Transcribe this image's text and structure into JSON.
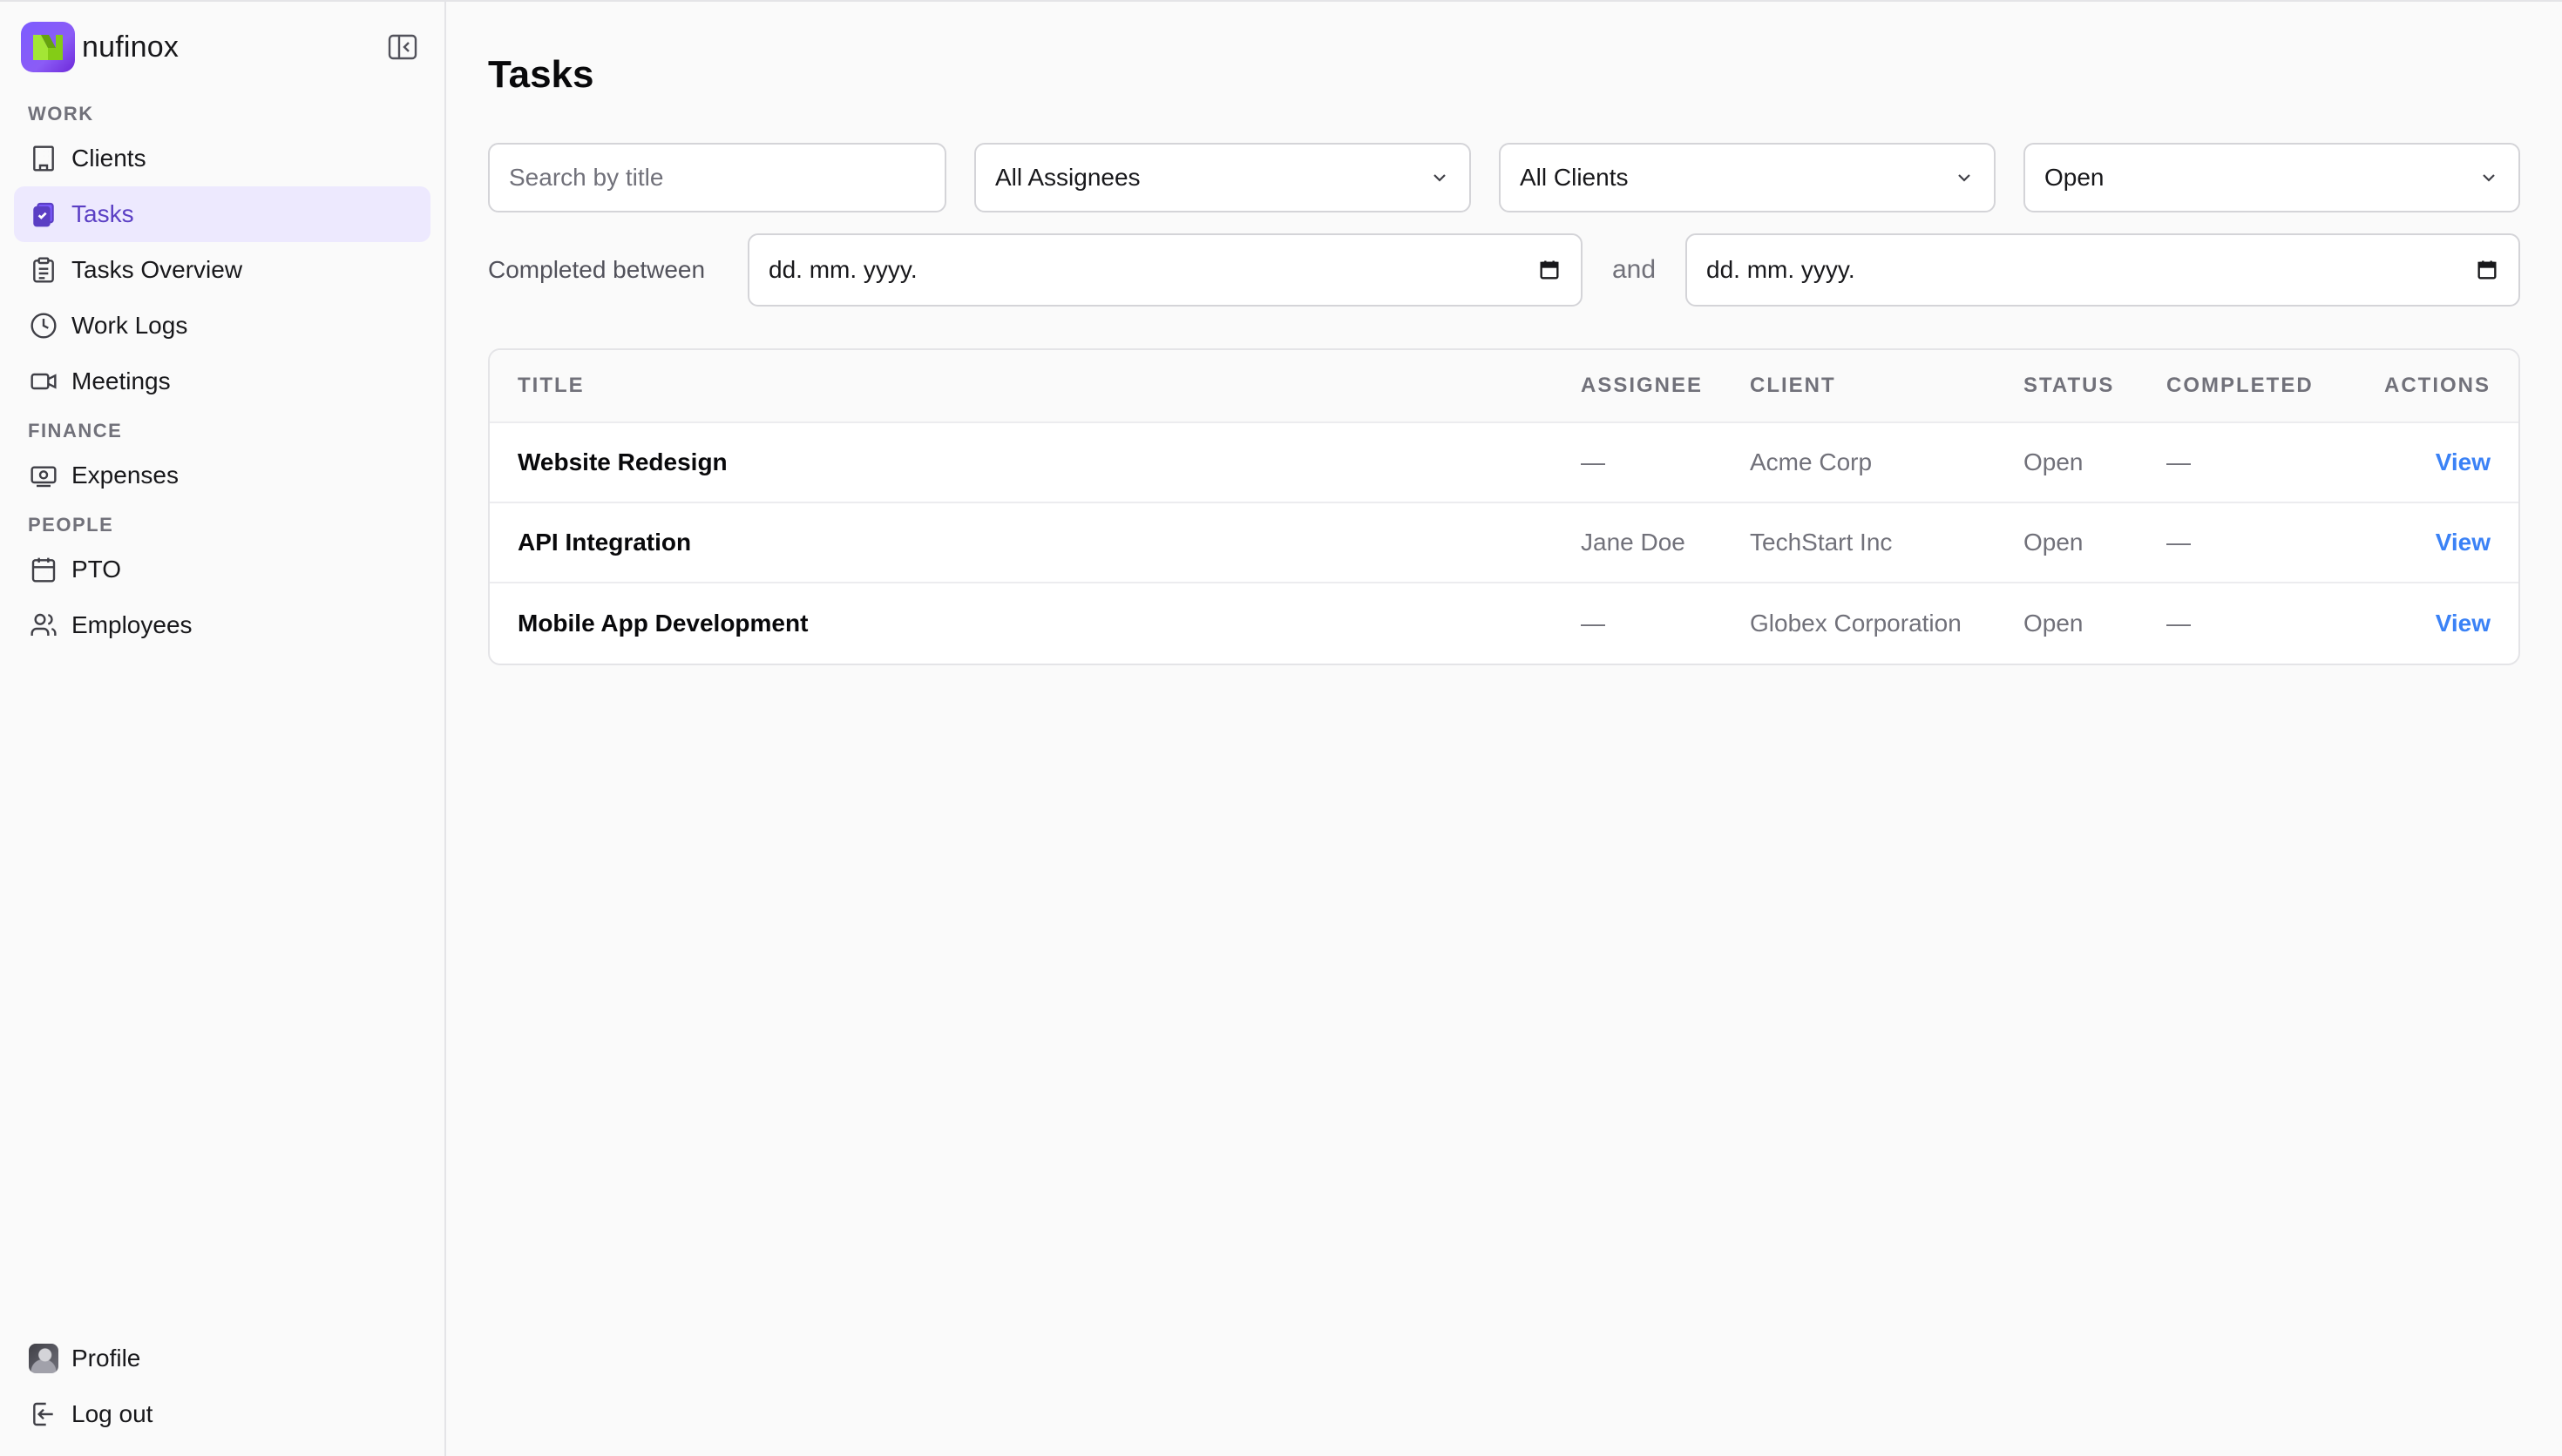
{
  "brand": {
    "name": "nufinox",
    "accent": "#7c5cff"
  },
  "sidebar": {
    "sections": {
      "work": "WORK",
      "finance": "FINANCE",
      "people": "PEOPLE"
    },
    "items": [
      {
        "label": "Clients",
        "icon": "building-icon"
      },
      {
        "label": "Tasks",
        "icon": "tasks-icon",
        "active": true
      },
      {
        "label": "Tasks Overview",
        "icon": "clipboard-icon"
      },
      {
        "label": "Work Logs",
        "icon": "clock-icon"
      },
      {
        "label": "Meetings",
        "icon": "video-icon"
      },
      {
        "label": "Expenses",
        "icon": "banknote-icon"
      },
      {
        "label": "PTO",
        "icon": "calendar-icon"
      },
      {
        "label": "Employees",
        "icon": "users-icon"
      }
    ],
    "bottom": [
      {
        "label": "Profile",
        "icon": "avatar"
      },
      {
        "label": "Log out",
        "icon": "logout-icon"
      }
    ]
  },
  "page": {
    "title": "Tasks"
  },
  "filters": {
    "search_placeholder": "Search by title",
    "assignee": "All Assignees",
    "client": "All Clients",
    "status": "Open",
    "completed_between_label": "Completed between",
    "date_from": "dd. mm. yyyy.",
    "and_label": "and",
    "date_to": "dd. mm. yyyy."
  },
  "table": {
    "columns": [
      "TITLE",
      "ASSIGNEE",
      "CLIENT",
      "STATUS",
      "COMPLETED",
      "ACTIONS"
    ],
    "rows": [
      {
        "title": "Website Redesign",
        "assignee": "—",
        "client": "Acme Corp",
        "status": "Open",
        "completed": "—",
        "action": "View"
      },
      {
        "title": "API Integration",
        "assignee": "Jane Doe",
        "client": "TechStart Inc",
        "status": "Open",
        "completed": "—",
        "action": "View"
      },
      {
        "title": "Mobile App Development",
        "assignee": "—",
        "client": "Globex Corporation",
        "status": "Open",
        "completed": "—",
        "action": "View"
      }
    ]
  },
  "colors": {
    "link": "#3b82f6",
    "active_bg": "#ede9fe",
    "active_text": "#5b3fc4"
  }
}
